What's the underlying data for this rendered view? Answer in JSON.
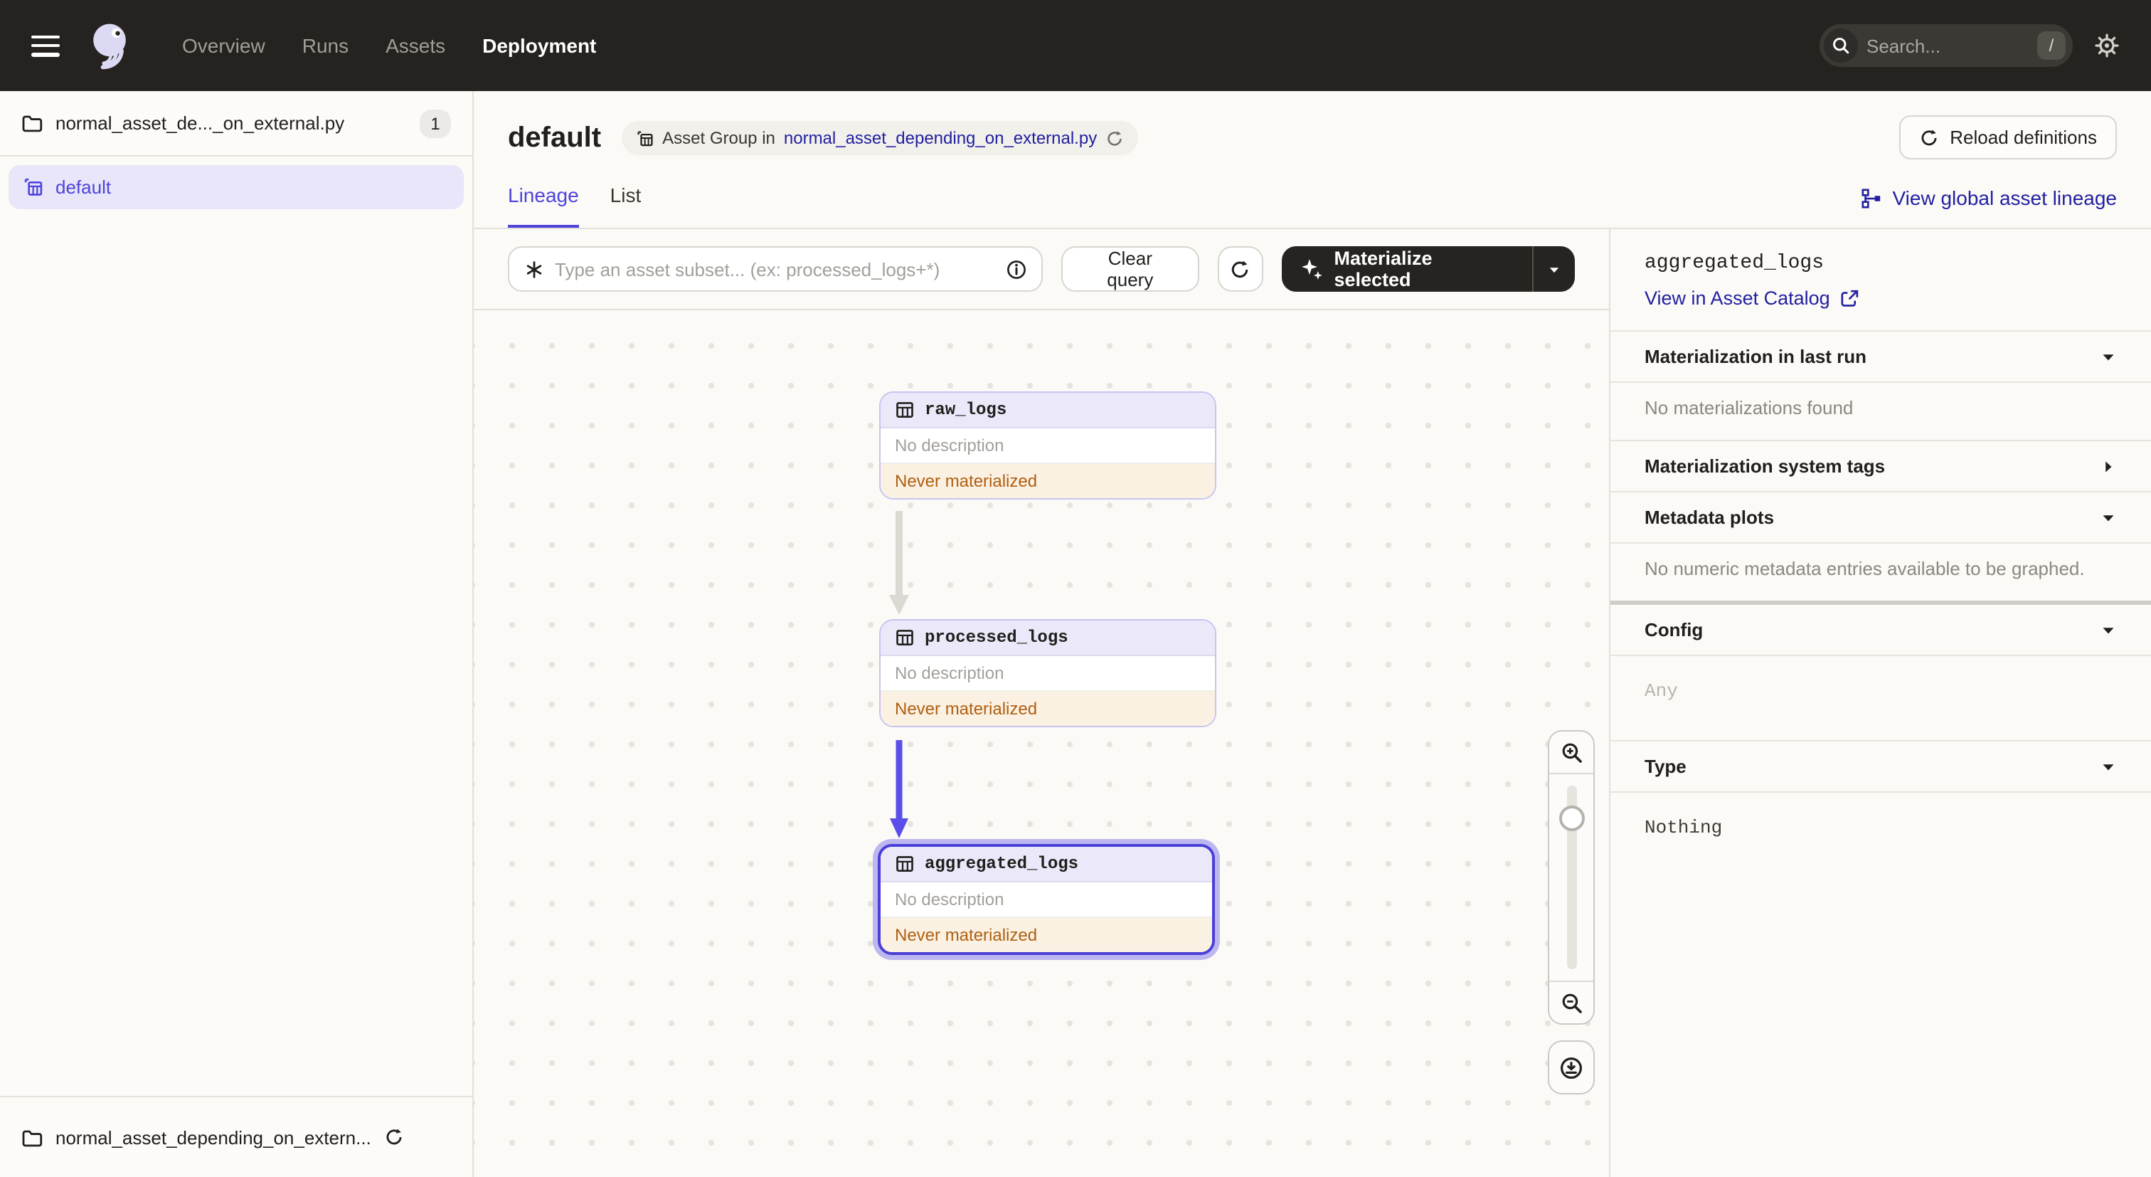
{
  "colors": {
    "accent": "#4F43DD",
    "link": "#221FA0",
    "nav_bg": "#262220",
    "warning_text": "#AF5F10",
    "warning_bg": "#FBF1E3",
    "node_border": "#C8C4EF",
    "node_header_bg": "#EAE8F9",
    "selected_border": "#4A3FD6",
    "arrow_gray": "#DCD9D3",
    "arrow_purple": "#5A4FE8"
  },
  "nav": {
    "links": [
      {
        "label": "Overview"
      },
      {
        "label": "Runs"
      },
      {
        "label": "Assets"
      },
      {
        "label": "Deployment"
      }
    ],
    "active_link": "Deployment",
    "search": {
      "placeholder": "Search...",
      "shortcut": "/"
    }
  },
  "sidebar": {
    "repo": {
      "name": "normal_asset_de..._on_external.py",
      "count": "1"
    },
    "group": {
      "label": "default"
    },
    "footer": {
      "name": "normal_asset_depending_on_extern..."
    }
  },
  "header": {
    "title": "default",
    "breadcrumb": {
      "prefix": "Asset Group in",
      "link": "normal_asset_depending_on_external.py"
    },
    "reload_label": "Reload definitions",
    "global_lineage_label": "View global asset lineage"
  },
  "tabs": [
    {
      "label": "Lineage",
      "active": true
    },
    {
      "label": "List",
      "active": false
    }
  ],
  "toolbar": {
    "query_placeholder": "Type an asset subset... (ex: processed_logs+*)",
    "clear_label": "Clear query",
    "materialize_label": "Materialize selected"
  },
  "graph": {
    "nodes": [
      {
        "name": "raw_logs",
        "description": "No description",
        "status": "Never materialized",
        "selected": false
      },
      {
        "name": "processed_logs",
        "description": "No description",
        "status": "Never materialized",
        "selected": false
      },
      {
        "name": "aggregated_logs",
        "description": "No description",
        "status": "Never materialized",
        "selected": true
      }
    ]
  },
  "panel": {
    "asset_name": "aggregated_logs",
    "catalog_link": "View in Asset Catalog",
    "mat_last_run_header": "Materialization in last run",
    "mat_empty": "No materializations found",
    "system_tags_header": "Materialization system tags",
    "metadata_header": "Metadata plots",
    "metadata_empty": "No numeric metadata entries available to be graphed.",
    "config_header": "Config",
    "config_value": "Any",
    "type_header": "Type",
    "type_value": "Nothing"
  }
}
